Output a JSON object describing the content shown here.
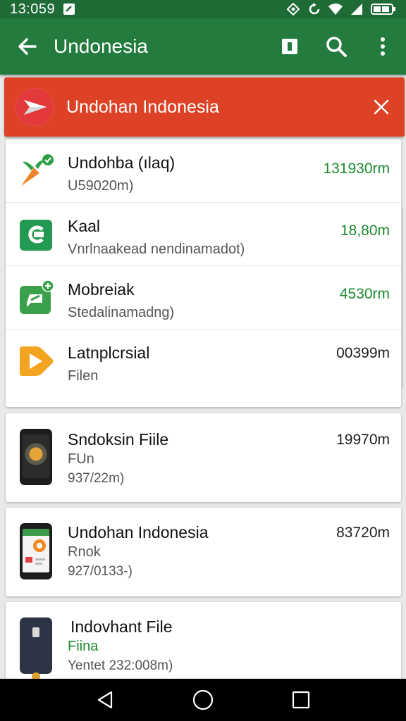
{
  "status_bar": {
    "time": "13:059"
  },
  "app_bar": {
    "title": "Undonesia"
  },
  "banner": {
    "title": "Undohan Indonesia"
  },
  "apps": [
    {
      "name": "Undohba (ılaq)",
      "sub": "U59020m)",
      "size": "131930rm",
      "size_color": "#1a8a2e"
    },
    {
      "name": "Kaal",
      "sub": "Vnrlnaakead nendinamadot)",
      "size": "18,80m",
      "size_color": "#1a8a2e"
    },
    {
      "name": "Mobreiak",
      "sub": "Stedalinamadng)",
      "size": "4530rm",
      "size_color": "#1a8a2e"
    },
    {
      "name": "Latnplcrsial",
      "sub": "Filen",
      "size": "00399m",
      "size_color": "#1e1e1e"
    }
  ],
  "files": [
    {
      "name": "Sndoksin Fiile",
      "type": "FUn",
      "meta": "937/22m)",
      "size": "19970m"
    },
    {
      "name": "Undohan Indonesia",
      "type": "Rnok",
      "meta": "927/0133-)",
      "size": "83720m"
    },
    {
      "name": "Indovhant File",
      "type": "Fiina",
      "meta": "Yentet 232:008m)",
      "size": ""
    }
  ]
}
